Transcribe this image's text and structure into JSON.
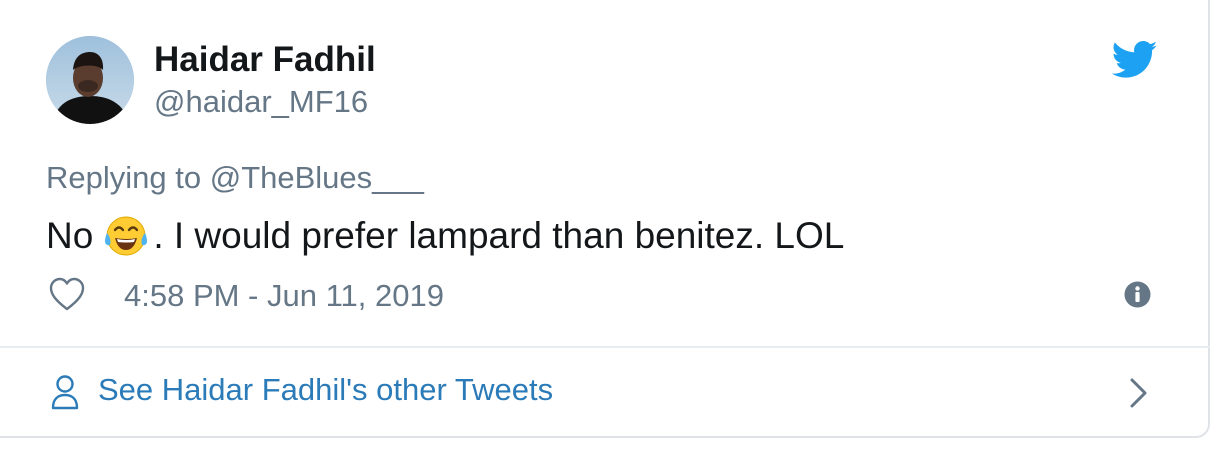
{
  "author": {
    "name": "Haidar Fadhil",
    "handle": "@haidar_MF16"
  },
  "tweet": {
    "replying_prefix": "Replying to",
    "replying_to": "@TheBlues___",
    "text_before_emoji": "No",
    "emoji": "face-with-tears-of-joy",
    "text_after_emoji": ". I would prefer lampard than benitez. LOL",
    "timestamp": "4:58 PM - Jun 11, 2019"
  },
  "footer": {
    "link_label": "See Haidar Fadhil's other Tweets"
  },
  "icons": {
    "brand": "twitter-bird-icon",
    "like": "heart-icon",
    "info": "info-icon",
    "profile": "person-icon",
    "navigate": "chevron-right-icon"
  },
  "colors": {
    "brand": "#1da1f2",
    "link": "#2b7bb9",
    "secondary_text": "#657786",
    "primary_text": "#14171a",
    "border": "#dfe3e7"
  }
}
